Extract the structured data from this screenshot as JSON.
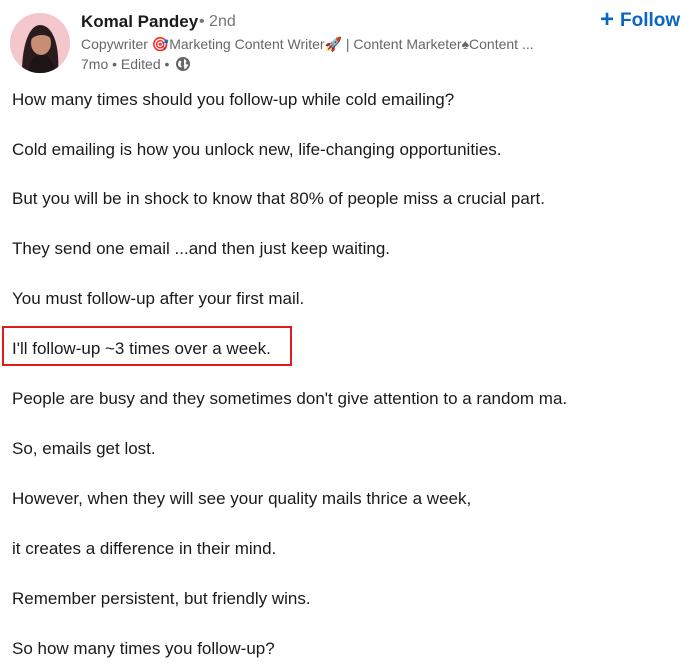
{
  "author": {
    "name": "Komal Pandey",
    "degree": "• 2nd",
    "headline": "Copywriter 🎯Marketing Content Writer🚀 | Content Marketer♠Content ...",
    "meta": "7mo • Edited •"
  },
  "follow": {
    "label": "Follow",
    "plus": "+"
  },
  "post": {
    "paragraphs": [
      "How many times should you follow-up while cold emailing?",
      "Cold emailing is how you unlock new, life-changing opportunities.",
      "But you will be in shock to know that 80% of people miss a crucial part.",
      "They send one email ...and then just keep waiting.",
      "You must follow-up after your first mail.",
      "I'll follow-up ~3 times over a week.",
      "People are busy and they sometimes don't give attention to a random ma.",
      "So, emails get lost.",
      "However, when they will see your quality mails thrice a week,",
      "it creates a difference in their mind.",
      "Remember persistent, but friendly wins.",
      "So how many times you follow-up?"
    ],
    "highlighted_index": 5
  },
  "colors": {
    "accent": "#0a66c2",
    "highlight": "#e01b1b",
    "text": "#1a1a1a",
    "muted": "#666666"
  },
  "icons": {
    "globe": "globe-icon",
    "avatar": "avatar"
  }
}
